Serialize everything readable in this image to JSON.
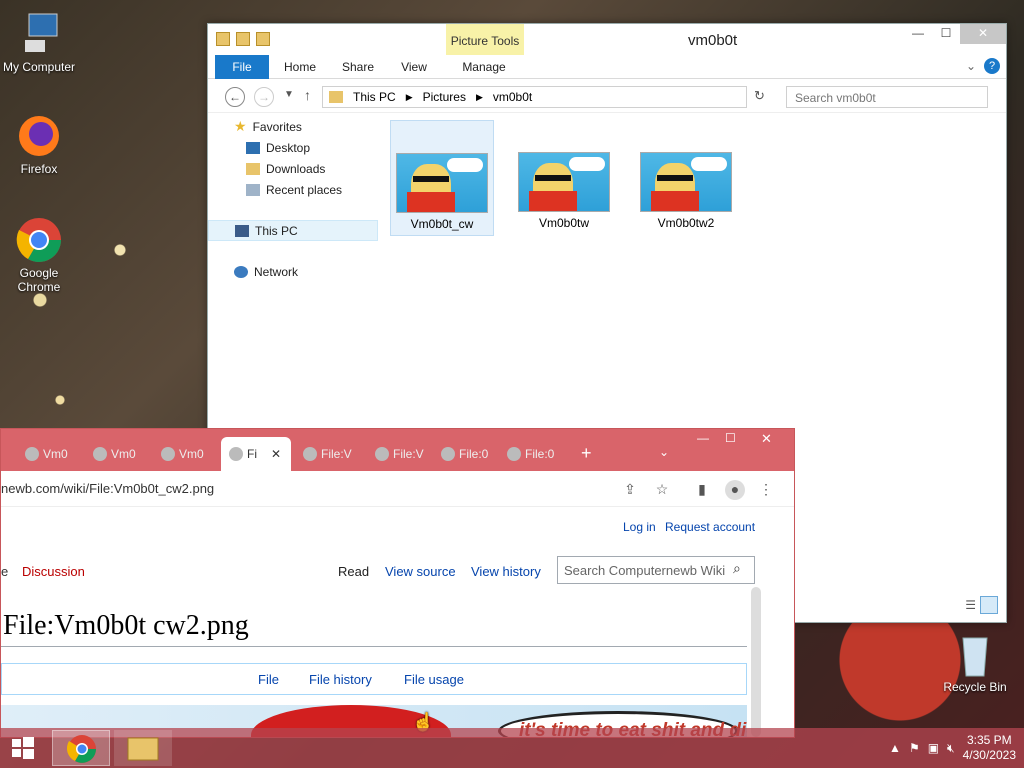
{
  "desktop": {
    "icons": [
      {
        "label": "My Computer"
      },
      {
        "label": "Firefox"
      },
      {
        "label": "Google Chrome"
      },
      {
        "label": "Recycle Bin"
      }
    ]
  },
  "explorer": {
    "title": "vm0b0t",
    "context_tab": "Picture Tools",
    "ribbon_tabs": [
      "File",
      "Home",
      "Share",
      "View",
      "Manage"
    ],
    "breadcrumb": [
      "This PC",
      "Pictures",
      "vm0b0t"
    ],
    "search_placeholder": "Search vm0b0t",
    "nav": {
      "favorites": "Favorites",
      "desktop": "Desktop",
      "downloads": "Downloads",
      "recent": "Recent places",
      "thispc": "This PC",
      "network": "Network"
    },
    "files": [
      {
        "name": "Vm0b0t_cw"
      },
      {
        "name": "Vm0b0tw"
      },
      {
        "name": "Vm0b0tw2"
      }
    ]
  },
  "chrome": {
    "tabs": [
      "Vm0",
      "Vm0",
      "Vm0",
      "Fi",
      "File:V",
      "File:V",
      "File:0",
      "File:0"
    ],
    "url": "newb.com/wiki/File:Vm0b0t_cw2.png",
    "wiki": {
      "login": "Log in",
      "request": "Request account",
      "tab_e": "e",
      "discussion": "Discussion",
      "read": "Read",
      "view_source": "View source",
      "view_history": "View history",
      "search_placeholder": "Search Computernewb Wiki",
      "title": "File:Vm0b0t cw2.png",
      "file_links": [
        "File",
        "File history",
        "File usage"
      ],
      "preview_text": "it's time to eat shit and die and chew"
    }
  },
  "taskbar": {
    "time": "3:35 PM",
    "date": "4/30/2023"
  }
}
